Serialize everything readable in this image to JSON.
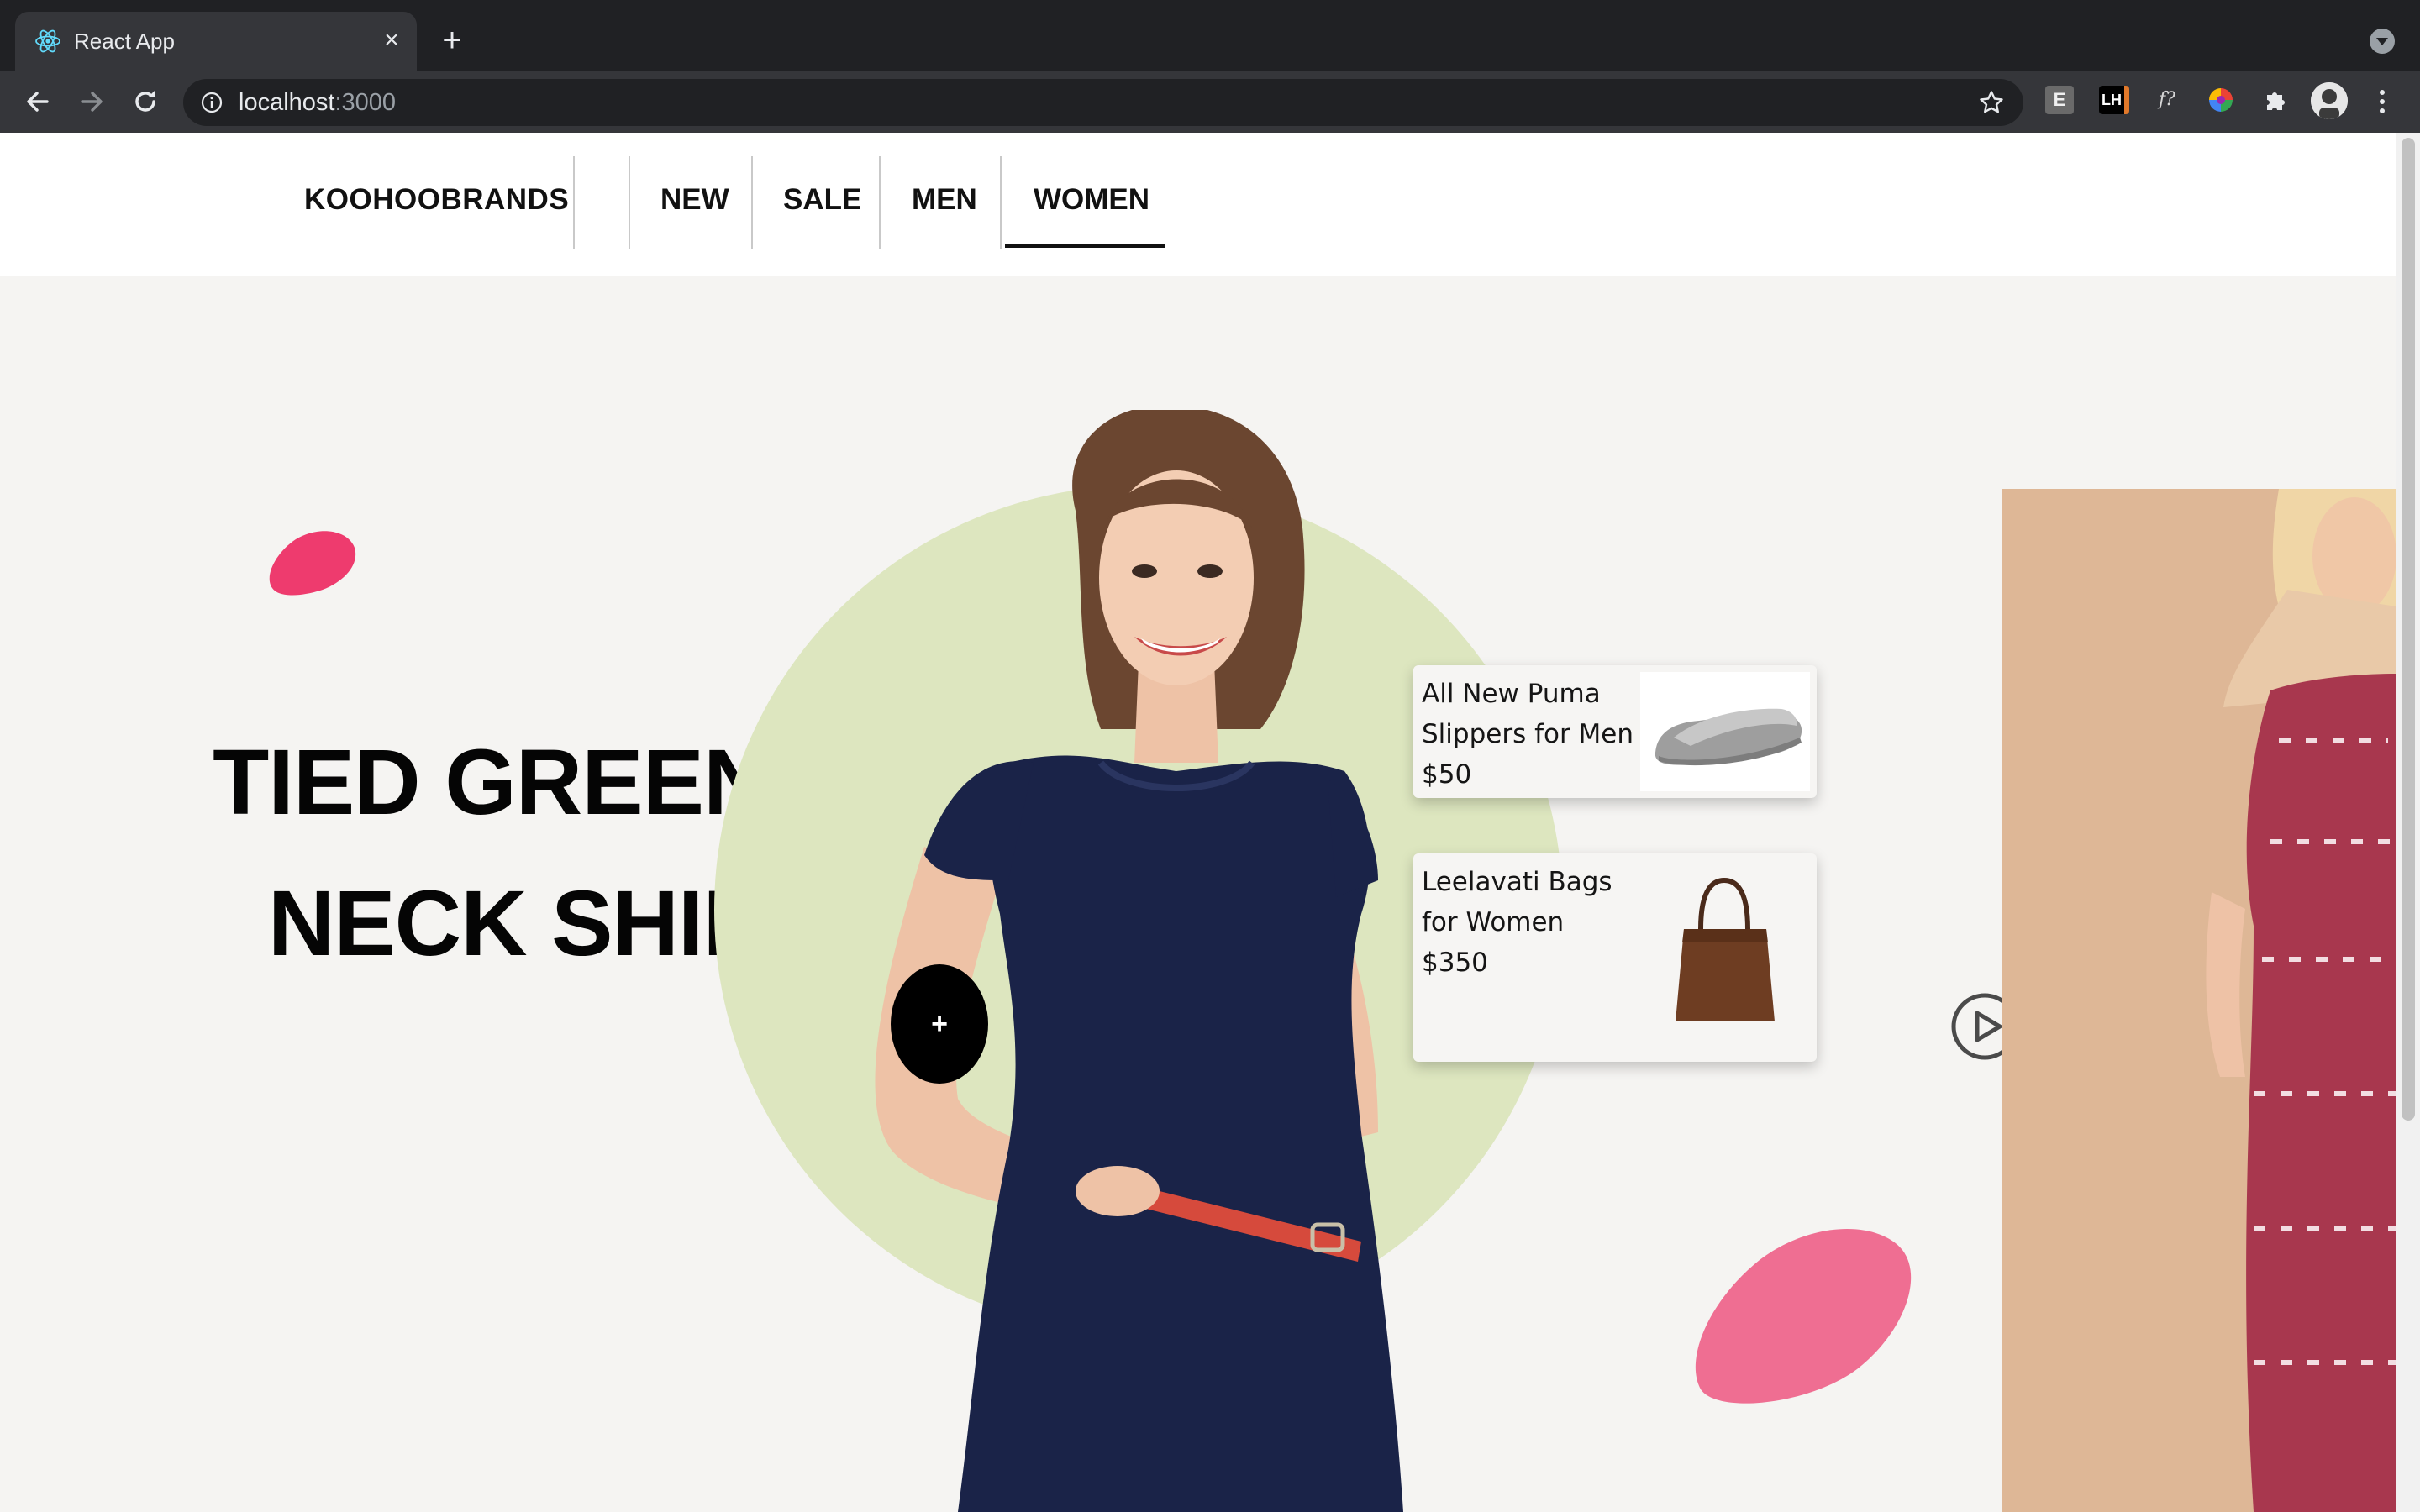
{
  "browser": {
    "tab": {
      "title": "React App",
      "favicon": "react-logo-icon"
    },
    "url": {
      "host": "localhost",
      "port": ":3000"
    },
    "extensions": [
      "E",
      "LH",
      "f?"
    ],
    "colors": {
      "tab_bg": "#35363a",
      "frame_bg": "#202124"
    }
  },
  "site": {
    "brand": "KOOHOOBRANDS",
    "nav": [
      {
        "label": "NEW",
        "active": false
      },
      {
        "label": "SALE",
        "active": false
      },
      {
        "label": "MEN",
        "active": false
      },
      {
        "label": "WOMEN",
        "active": true
      }
    ]
  },
  "hero": {
    "headline_line1": "TIED GREEN V-",
    "headline_line2": "NECK SHIRT",
    "plus_label": "+",
    "colors": {
      "circle": "#dde6bf",
      "blob": "#ee3b6e",
      "blob_large": "#ef6e92",
      "background": "#f5f4f2"
    }
  },
  "products": [
    {
      "name_line1": "All New Puma",
      "name_line2": "Slippers for Men",
      "price": "$50",
      "image": "slipper-image"
    },
    {
      "name_line1": "Leelavati Bags",
      "name_line2": "for Women",
      "price": "$350",
      "image": "handbag-image"
    }
  ]
}
